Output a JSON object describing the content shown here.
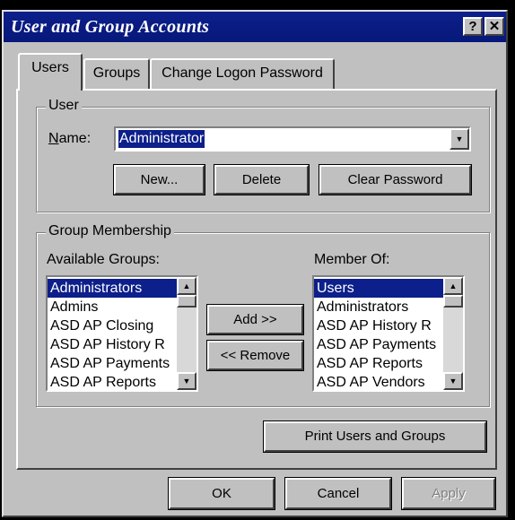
{
  "window": {
    "title": "User and Group Accounts",
    "help_glyph": "?",
    "close_glyph": "✕"
  },
  "tabs": [
    {
      "label": "Users",
      "active": true
    },
    {
      "label": "Groups",
      "active": false
    },
    {
      "label": "Change Logon Password",
      "active": false
    }
  ],
  "user_group": {
    "title": "User",
    "name_label": "Name:",
    "name_value": "Administrator",
    "buttons": {
      "new": "New...",
      "delete": "Delete",
      "clear_password": "Clear Password"
    }
  },
  "membership": {
    "title": "Group Membership",
    "available_label": "Available Groups:",
    "member_label": "Member Of:",
    "available": [
      "Administrators",
      "Admins",
      "ASD AP Closing",
      "ASD AP History R",
      "ASD AP Payments",
      "ASD AP Reports"
    ],
    "member_of": [
      "Users",
      "Administrators",
      "ASD AP History R",
      "ASD AP Payments",
      "ASD AP Reports",
      "ASD AP Vendors"
    ],
    "add_button": "Add >>",
    "remove_button": "<< Remove"
  },
  "print_button": "Print Users and Groups",
  "footer": {
    "ok": "OK",
    "cancel": "Cancel",
    "apply": "Apply"
  },
  "colors": {
    "titlebar": "#0c1f8a",
    "face": "#c0c0c0",
    "selection": "#0c1f8a"
  }
}
